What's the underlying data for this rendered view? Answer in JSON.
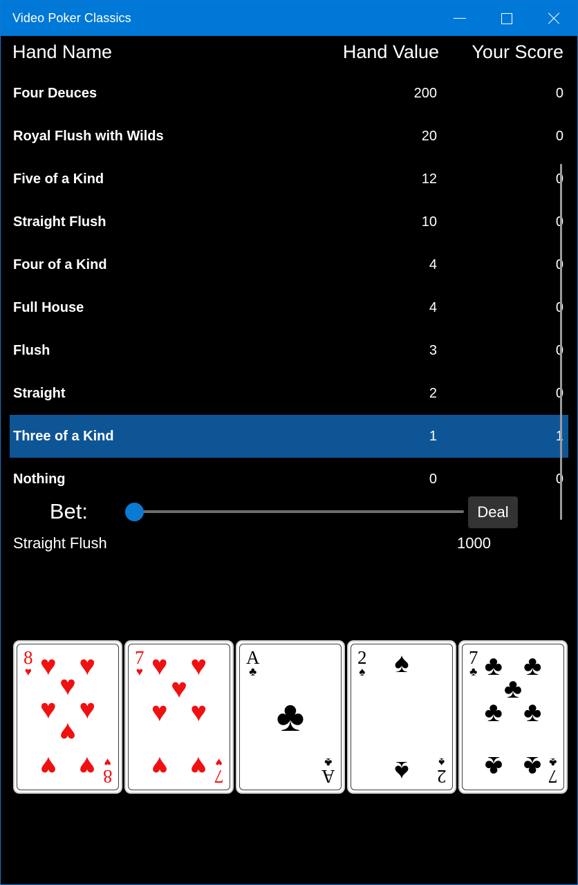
{
  "window": {
    "title": "Video Poker Classics",
    "accent_color": "#0078D7",
    "background_color": "#000000",
    "controls": {
      "minimize": "–",
      "maximize": "□",
      "close": "✕"
    }
  },
  "table": {
    "headers": {
      "name": "Hand Name",
      "value": "Hand Value",
      "score": "Your Score"
    },
    "selected_index": 8,
    "selected_color": "#0E5596",
    "rows": [
      {
        "name": "Four Deuces",
        "value": "200",
        "score": "0"
      },
      {
        "name": "Royal Flush with Wilds",
        "value": "20",
        "score": "0"
      },
      {
        "name": "Five of a Kind",
        "value": "12",
        "score": "0"
      },
      {
        "name": "Straight Flush",
        "value": "10",
        "score": "0"
      },
      {
        "name": "Four of a Kind",
        "value": "4",
        "score": "0"
      },
      {
        "name": "Full House",
        "value": "4",
        "score": "0"
      },
      {
        "name": "Flush",
        "value": "3",
        "score": "0"
      },
      {
        "name": "Straight",
        "value": "2",
        "score": "0"
      },
      {
        "name": "Three of a Kind",
        "value": "1",
        "score": "1"
      },
      {
        "name": "Nothing",
        "value": "0",
        "score": "0"
      }
    ]
  },
  "bet": {
    "label": "Bet:",
    "slider_value": 0,
    "slider_min": 0,
    "slider_max": 100,
    "thumb_color": "#0A7BD4",
    "track_color": "#6D6D6D",
    "deal_label": "Deal"
  },
  "status": {
    "hand_result": "Straight Flush",
    "credits": "1000"
  },
  "hand": {
    "cards": [
      {
        "rank": "8",
        "suit": "♥",
        "color": "red",
        "suit_name": "hearts",
        "count": 8
      },
      {
        "rank": "7",
        "suit": "♥",
        "color": "red",
        "suit_name": "hearts",
        "count": 7
      },
      {
        "rank": "A",
        "suit": "♣",
        "color": "black",
        "suit_name": "clubs",
        "count": 1
      },
      {
        "rank": "2",
        "suit": "♠",
        "color": "black",
        "suit_name": "spades",
        "count": 2
      },
      {
        "rank": "7",
        "suit": "♣",
        "color": "black",
        "suit_name": "clubs",
        "count": 7
      }
    ]
  }
}
